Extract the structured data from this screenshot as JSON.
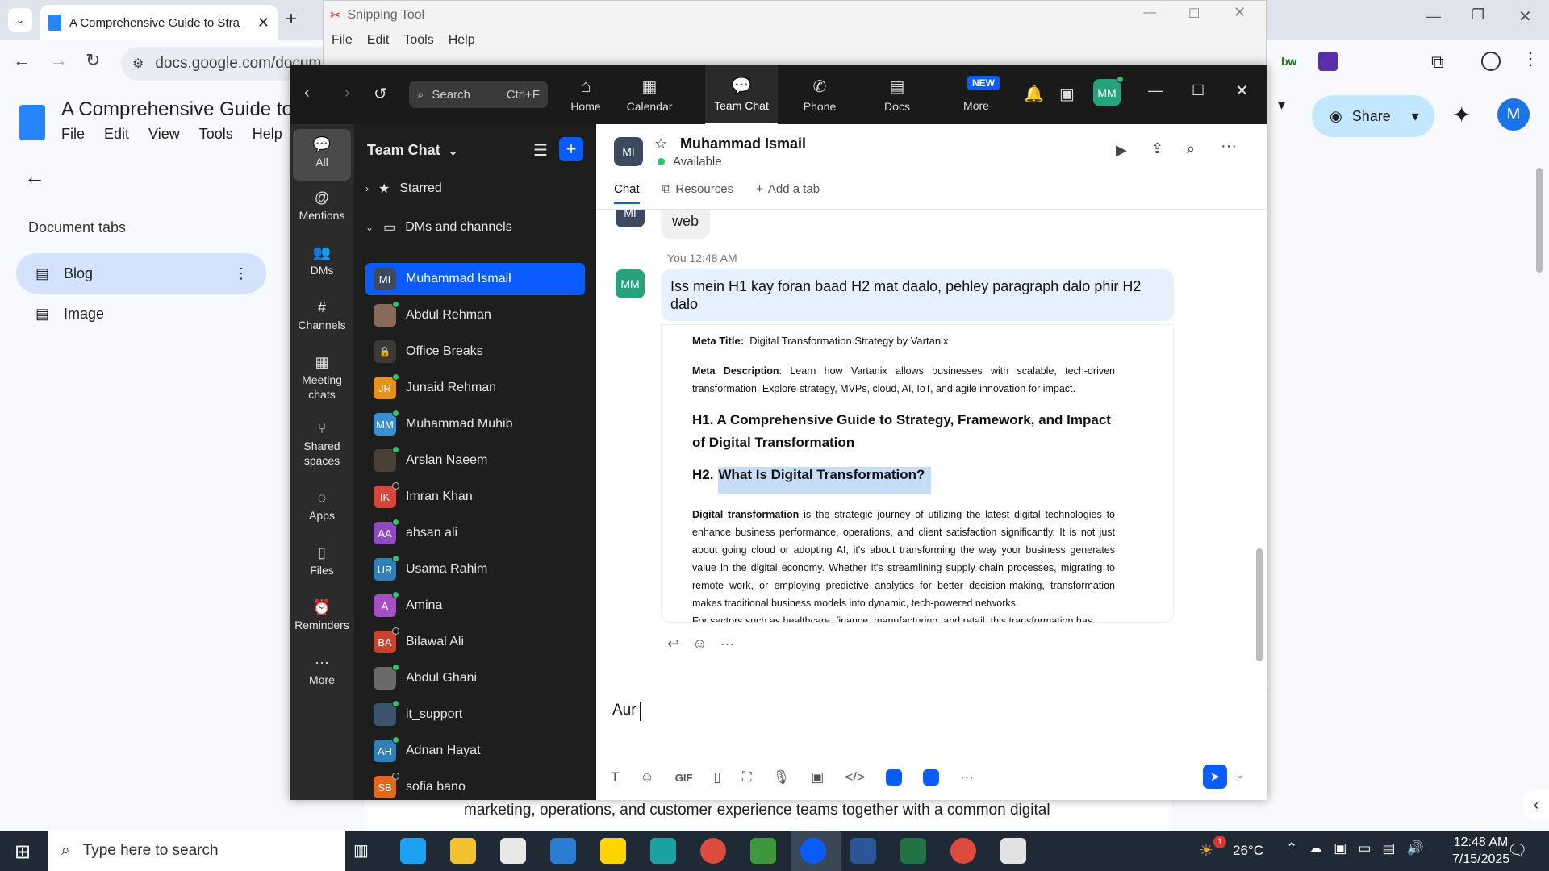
{
  "browser": {
    "tab_title": "A Comprehensive Guide to Stra",
    "url": "docs.google.com/docum"
  },
  "docs": {
    "title": "A Comprehensive Guide to S",
    "menu": [
      "File",
      "Edit",
      "View",
      "Tools",
      "Help"
    ],
    "document_tabs_label": "Document tabs",
    "tabs": [
      {
        "label": "Blog"
      },
      {
        "label": "Image"
      }
    ],
    "share_label": "Share",
    "avatar_letter": "M",
    "body_line": "marketing, operations, and customer experience teams together with a common digital"
  },
  "snipping": {
    "title": "Snipping Tool",
    "menu": [
      "File",
      "Edit",
      "Tools",
      "Help"
    ]
  },
  "zoom": {
    "search_placeholder": "Search",
    "search_shortcut": "Ctrl+F",
    "nav": [
      {
        "label": "Home",
        "icon": "home-icon"
      },
      {
        "label": "Calendar",
        "icon": "calendar-icon"
      },
      {
        "label": "Team Chat",
        "icon": "chat-icon"
      },
      {
        "label": "Phone",
        "icon": "phone-icon"
      },
      {
        "label": "Docs",
        "icon": "docs-icon"
      },
      {
        "label": "More",
        "icon": "more-icon",
        "badge": "NEW"
      }
    ],
    "user_initials": "MM",
    "rail": [
      {
        "label": "All"
      },
      {
        "label": "Mentions"
      },
      {
        "label": "DMs"
      },
      {
        "label": "Channels"
      },
      {
        "label": "Meeting chats"
      },
      {
        "label": "Shared spaces"
      },
      {
        "label": "Apps"
      },
      {
        "label": "Files"
      },
      {
        "label": "Reminders"
      },
      {
        "label": "More"
      }
    ],
    "list_title": "Team Chat",
    "starred_label": "Starred",
    "dms_label": "DMs and channels",
    "contacts": [
      {
        "name": "Muhammad Ismail",
        "initials": "MI",
        "color": "#3b4a5e",
        "status": "none",
        "selected": true
      },
      {
        "name": "Abdul Rehman",
        "initials": "",
        "color": "#8a6b5a",
        "status": "online"
      },
      {
        "name": "Office Breaks",
        "initials": "",
        "color": "#3a3a3a",
        "status": "none"
      },
      {
        "name": "Junaid Rehman",
        "initials": "JR",
        "color": "#e8901c",
        "status": "online"
      },
      {
        "name": "Muhammad Muhib",
        "initials": "MM",
        "color": "#3a8fd4",
        "status": "online"
      },
      {
        "name": "Arslan Naeem",
        "initials": "",
        "color": "#4a4035",
        "status": "online"
      },
      {
        "name": "Imran Khan",
        "initials": "IK",
        "color": "#d8453b",
        "status": "offline"
      },
      {
        "name": "ahsan ali",
        "initials": "AA",
        "color": "#8e4bc2",
        "status": "online"
      },
      {
        "name": "Usama Rahim",
        "initials": "UR",
        "color": "#2f7fb8",
        "status": "online"
      },
      {
        "name": "Amina",
        "initials": "A",
        "color": "#a44fc4",
        "status": "online"
      },
      {
        "name": "Bilawal Ali",
        "initials": "BA",
        "color": "#c8432f",
        "status": "offline"
      },
      {
        "name": "Abdul Ghani",
        "initials": "",
        "color": "#6a6a6a",
        "status": "online"
      },
      {
        "name": "it_support",
        "initials": "",
        "color": "#3d5470",
        "status": "online"
      },
      {
        "name": "Adnan Hayat",
        "initials": "AH",
        "color": "#2f7fb8",
        "status": "online"
      },
      {
        "name": "sofia bano",
        "initials": "SB",
        "color": "#e06a1c",
        "status": "offline"
      }
    ],
    "chat": {
      "name": "Muhammad Ismail",
      "initials": "MI",
      "status": "Available",
      "tabs": [
        "Chat",
        "Resources",
        "Add a tab"
      ],
      "prev_bubble": "web",
      "msg_meta": "You 12:48 AM",
      "msg_text": "Iss mein H1 kay foran baad H2 mat daalo, pehley paragraph dalo phir H2 dalo",
      "doc": {
        "meta_title_label": "Meta Title:",
        "meta_title": "Digital Transformation Strategy by Vartanix",
        "meta_desc_label": "Meta Description",
        "meta_desc": ":  Learn how Vartanix allows businesses with scalable, tech-driven transformation. Explore strategy, MVPs, cloud, AI, IoT, and agile innovation for impact.",
        "h1": "H1. A Comprehensive Guide to Strategy, Framework, and Impact of Digital Transformation",
        "h2_prefix": "H2.",
        "h2": "What Is Digital Transformation?",
        "para_link": "Digital transformation",
        "para": " is the strategic journey of utilizing the latest digital technologies to enhance business performance, operations, and client satisfaction significantly. It is not just about going cloud or adopting AI, it's about transforming the way your business generates value in the digital economy. Whether it's streamlining supply chain processes, migrating to remote work, or employing predictive analytics for better decision-making, transformation makes traditional business models into dynamic, tech-powered networks.",
        "para2": "For sectors such as healthcare, finance, manufacturing, and retail, this transformation has"
      },
      "composer_text": "Aur"
    }
  },
  "taskbar": {
    "search_placeholder": "Type here to search",
    "temperature": "26°C",
    "time": "12:48 AM",
    "date": "7/15/2025",
    "weather_badge": "1"
  }
}
